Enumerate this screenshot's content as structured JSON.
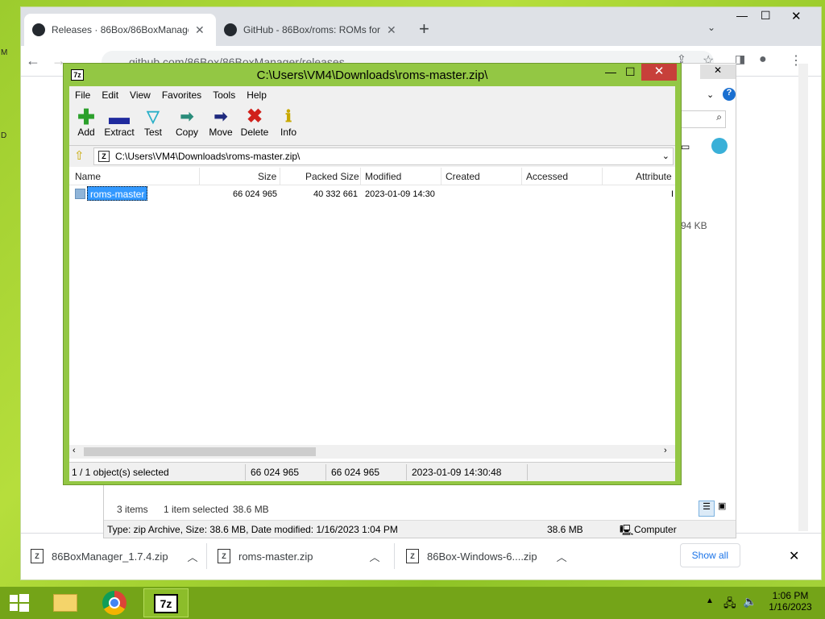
{
  "chrome": {
    "tabs": [
      {
        "title": "Releases · 86Box/86BoxManager",
        "active": true
      },
      {
        "title": "GitHub - 86Box/roms: ROMs for",
        "active": false
      }
    ],
    "new_tab": "+",
    "url": "github.com/86Box/86BoxManager/releases",
    "downloads": [
      {
        "name": "86BoxManager_1.7.4.zip"
      },
      {
        "name": "roms-master.zip"
      },
      {
        "name": "86Box-Windows-6....zip"
      }
    ],
    "show_all": "Show all"
  },
  "explorer": {
    "size_fragment": "94 KB",
    "items_count": "3 items",
    "selected_info": "1 item selected",
    "selected_size": "38.6 MB",
    "status_type": "Type: zip Archive, Size: 38.6 MB, Date modified: 1/16/2023 1:04 PM",
    "status_size": "38.6 MB",
    "status_location": "Computer"
  },
  "sevenzip": {
    "title": "C:\\Users\\VM4\\Downloads\\roms-master.zip\\",
    "menu": [
      "File",
      "Edit",
      "View",
      "Favorites",
      "Tools",
      "Help"
    ],
    "toolbar": [
      {
        "label": "Add",
        "icon": "plus-icon",
        "color": "#2ca02c"
      },
      {
        "label": "Extract",
        "icon": "minus-icon",
        "color": "#1f2a9e"
      },
      {
        "label": "Test",
        "icon": "check-icon",
        "color": "#2bb0c8"
      },
      {
        "label": "Copy",
        "icon": "copy-arrow-icon",
        "color": "#2a8c7a"
      },
      {
        "label": "Move",
        "icon": "move-arrow-icon",
        "color": "#1f2a7e"
      },
      {
        "label": "Delete",
        "icon": "delete-x-icon",
        "color": "#d0201a"
      },
      {
        "label": "Info",
        "icon": "info-icon",
        "color": "#c8a800"
      }
    ],
    "path": "C:\\Users\\VM4\\Downloads\\roms-master.zip\\",
    "columns": [
      "Name",
      "Size",
      "Packed Size",
      "Modified",
      "Created",
      "Accessed",
      "Attribute"
    ],
    "rows": [
      {
        "name": "roms-master",
        "size": "66 024 965",
        "packed": "40 332 661",
        "modified": "2023-01-09 14:30",
        "created": "",
        "accessed": "",
        "attr": "I"
      }
    ],
    "status": {
      "selected": "1 / 1 object(s) selected",
      "size": "66 024 965",
      "packed": "66 024 965",
      "modified": "2023-01-09 14:30:48"
    }
  },
  "taskbar": {
    "time": "1:06 PM",
    "date": "1/16/2023"
  }
}
